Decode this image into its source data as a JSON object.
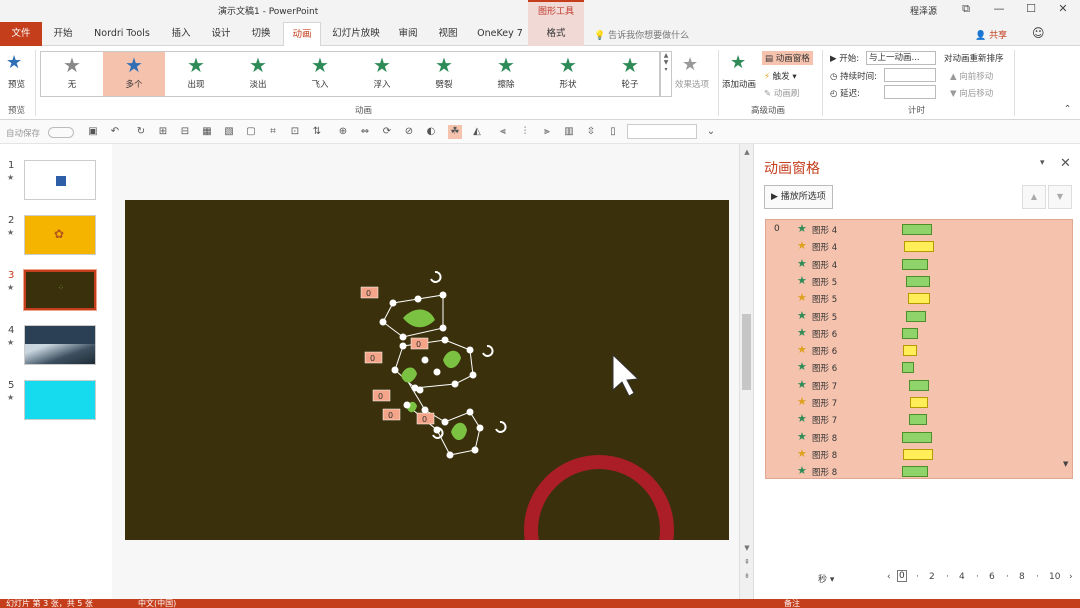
{
  "titlebar": {
    "document": "演示文稿1 - PowerPoint",
    "context_tools": "图形工具",
    "user": "程泽源",
    "restore_icon": "⧉",
    "minimize_icon": "—",
    "maximize_icon": "☐",
    "close_icon": "✕"
  },
  "tabs": {
    "file": "文件",
    "home": "开始",
    "nordri": "Nordri Tools",
    "insert": "插入",
    "design": "设计",
    "transitions": "切换",
    "animations": "动画",
    "slideshow": "幻灯片放映",
    "review": "审阅",
    "view": "视图",
    "onekey": "OneKey 7",
    "format": "格式",
    "tellme": "告诉我你想要做什么",
    "share": "共享"
  },
  "ribbon": {
    "preview_label": "预览",
    "preview_group": "预览",
    "animation_group": "动画",
    "effects": [
      "无",
      "多个",
      "出现",
      "淡出",
      "飞入",
      "浮入",
      "劈裂",
      "擦除",
      "形状",
      "轮子"
    ],
    "effect_options": "效果选项",
    "advanced_group": "高级动画",
    "add_animation": "添加动画",
    "animation_pane_btn": "动画窗格",
    "trigger": "触发",
    "painter": "动画刷",
    "timing_group": "计时",
    "start_label": "开始:",
    "start_value": "与上一动画...",
    "duration_label": "持续时间:",
    "delay_label": "延迟:",
    "reorder_title": "对动画重新排序",
    "move_earlier": "向前移动",
    "move_later": "向后移动"
  },
  "qat": {
    "autosave": "自动保存",
    "toggle_state": "关"
  },
  "thumbnails": [
    {
      "num": "1",
      "star": "★",
      "bg": "#ffffff"
    },
    {
      "num": "2",
      "star": "★",
      "bg": "#f5b400"
    },
    {
      "num": "3",
      "star": "★",
      "bg": "#3b300c"
    },
    {
      "num": "4",
      "star": "★",
      "bg": "#2b3f55"
    },
    {
      "num": "5",
      "star": "★",
      "bg": "#16dbee"
    }
  ],
  "slide": {
    "tags": [
      "0",
      "0",
      "0",
      "0",
      "0",
      "0"
    ]
  },
  "pane": {
    "title": "动画窗格",
    "play_button": "播放所选项",
    "first_index": "0",
    "rows": [
      {
        "name": "图形 4",
        "kind": "green"
      },
      {
        "name": "图形 4",
        "kind": "yellow"
      },
      {
        "name": "图形 4",
        "kind": "green"
      },
      {
        "name": "图形 5",
        "kind": "green"
      },
      {
        "name": "图形 5",
        "kind": "yellow"
      },
      {
        "name": "图形 5",
        "kind": "green"
      },
      {
        "name": "图形 6",
        "kind": "green"
      },
      {
        "name": "图形 6",
        "kind": "yellow"
      },
      {
        "name": "图形 6",
        "kind": "green"
      },
      {
        "name": "图形 7",
        "kind": "green"
      },
      {
        "name": "图形 7",
        "kind": "yellow"
      },
      {
        "name": "图形 7",
        "kind": "green"
      },
      {
        "name": "图形 8",
        "kind": "green"
      },
      {
        "name": "图形 8",
        "kind": "yellow"
      },
      {
        "name": "图形 8",
        "kind": "green"
      }
    ],
    "timeline_unit": "秒",
    "timeline_ticks": [
      "2",
      "4",
      "6",
      "8",
      "10"
    ],
    "timeline_start": "0"
  },
  "colors": {
    "accent": "#c43e1c",
    "selection": "#f4c2ad",
    "slide_bg": "#3b300c",
    "entrance_star": "#2e8b57",
    "emphasis_star": "#e0a020"
  },
  "status": {
    "slide_info": "幻灯片 第 3 张，共 5 张",
    "language": "中文(中国)",
    "notes": "备注"
  }
}
